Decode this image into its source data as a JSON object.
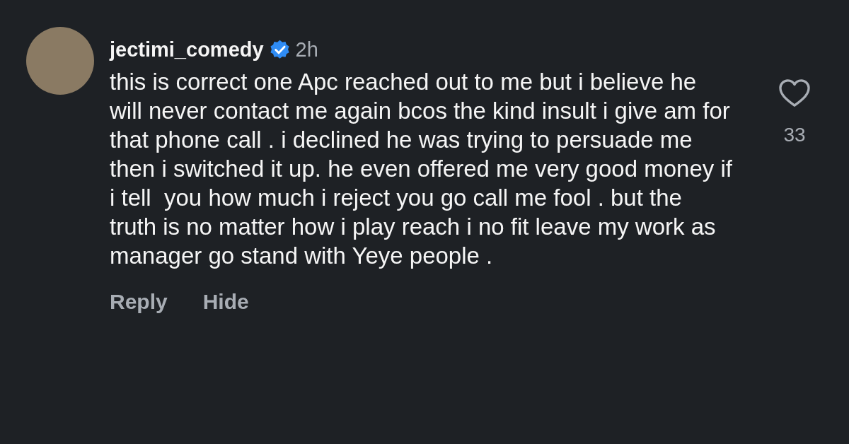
{
  "comment": {
    "username": "jectimi_comedy",
    "verified": true,
    "time": "2h",
    "text": "this is correct one Apc reached out to me but i believe he will never contact me again bcos the kind insult i give am for that phone call . i declined he was trying to persuade me then i switched it up. he even offered me very good money if i tell  you how much i reject you go call me fool . but the truth is no matter how i play reach i no fit leave my work as manager go stand with Yeye people .",
    "liked": false,
    "like_count": "33",
    "actions": [
      "Reply",
      "Hide"
    ]
  }
}
